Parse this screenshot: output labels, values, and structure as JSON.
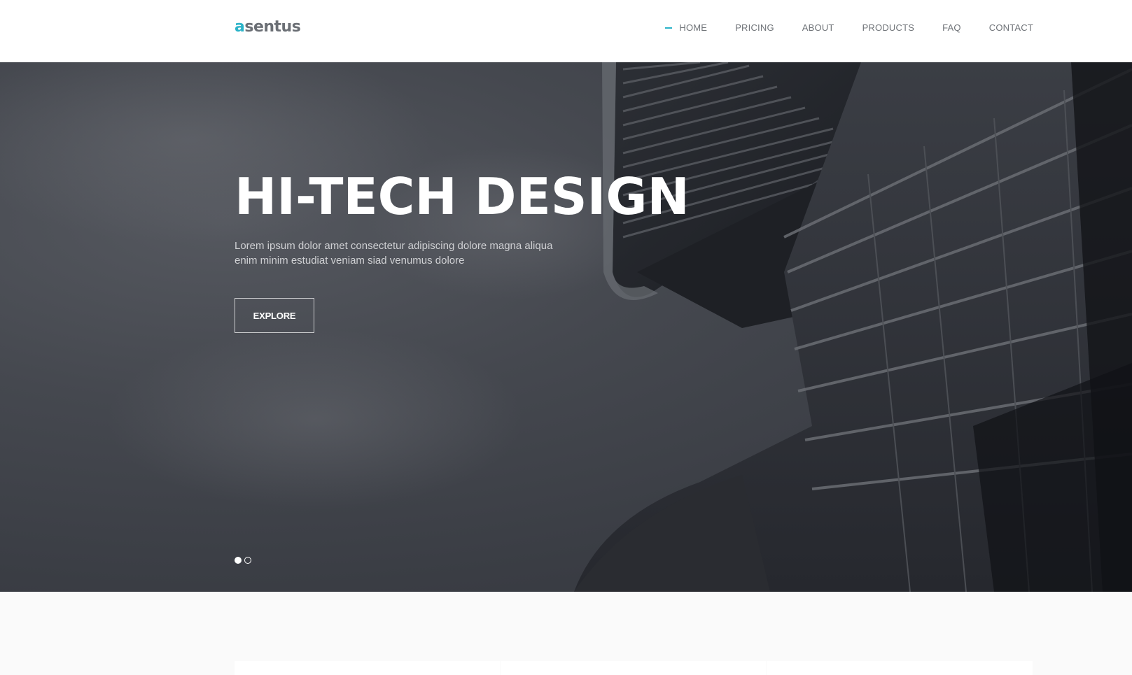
{
  "header": {
    "logo_accent": "a",
    "logo_rest": "sentus",
    "nav": [
      {
        "label": "HOME",
        "active": true
      },
      {
        "label": "PRICING",
        "active": false
      },
      {
        "label": "ABOUT",
        "active": false
      },
      {
        "label": "PRODUCTS",
        "active": false
      },
      {
        "label": "FAQ",
        "active": false
      },
      {
        "label": "CONTACT",
        "active": false
      }
    ]
  },
  "hero": {
    "title": "HI-TECH DESIGN",
    "text_line1": "Lorem ipsum dolor amet consectetur adipiscing dolore magna aliqua",
    "text_line2": "enim minim estudiat veniam siad venumus dolore",
    "button_label": "EXPLORE",
    "slides_total": 2,
    "slide_active": 1
  },
  "colors": {
    "accent": "#2bb3c8",
    "nav_text": "#6f7378",
    "logo_text": "#6b6f75",
    "hero_overlay": "#3a3d44"
  },
  "icons": {
    "active_nav_marker": "dash-marker-icon"
  }
}
